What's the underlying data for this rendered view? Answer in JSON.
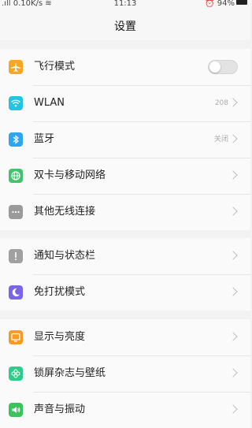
{
  "status_bar": {
    "signal_speed": "0.10K/s",
    "time": "11:13",
    "battery_text": "94%"
  },
  "header": {
    "title": "设置"
  },
  "groups": [
    {
      "items": [
        {
          "label": "飞行模式",
          "icon": "airplane-icon",
          "color": "#f5a623",
          "control": "toggle",
          "toggle_on": false
        },
        {
          "label": "WLAN",
          "icon": "wifi-icon",
          "color": "#23c4e0",
          "value": "208",
          "control": "chevron"
        },
        {
          "label": "蓝牙",
          "icon": "bluetooth-icon",
          "color": "#2fa5f0",
          "value": "关闭",
          "control": "chevron"
        },
        {
          "label": "双卡与移动网络",
          "icon": "globe-icon",
          "color": "#43c36d",
          "control": "chevron"
        },
        {
          "label": "其他无线连接",
          "icon": "more-icon",
          "color": "#9a9a9a",
          "control": "chevron"
        }
      ]
    },
    {
      "items": [
        {
          "label": "通知与状态栏",
          "icon": "notification-icon",
          "color": "#a0a0a0",
          "control": "chevron"
        },
        {
          "label": "免打扰模式",
          "icon": "moon-icon",
          "color": "#7a64e8",
          "control": "chevron"
        }
      ]
    },
    {
      "items": [
        {
          "label": "显示与亮度",
          "icon": "display-icon",
          "color": "#f59a23",
          "control": "chevron"
        },
        {
          "label": "锁屏杂志与壁纸",
          "icon": "flower-icon",
          "color": "#2ecc8a",
          "control": "chevron"
        },
        {
          "label": "声音与振动",
          "icon": "sound-icon",
          "color": "#3bc45c",
          "control": "chevron"
        }
      ]
    }
  ]
}
